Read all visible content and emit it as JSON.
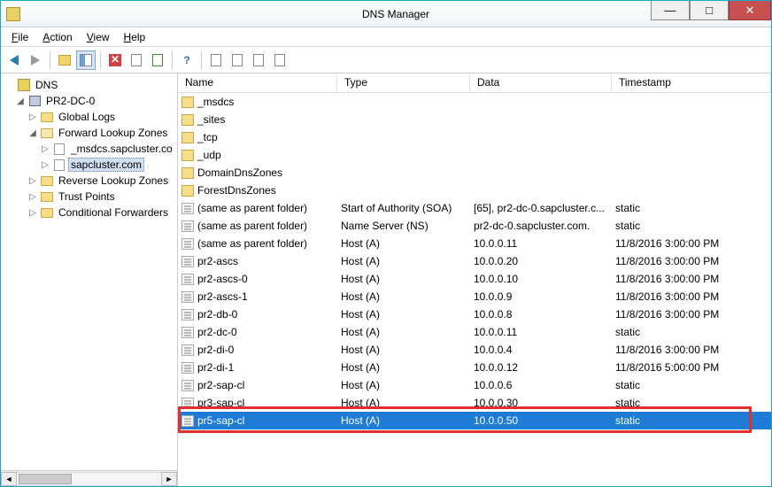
{
  "window": {
    "title": "DNS Manager"
  },
  "menus": {
    "file": "File",
    "action": "Action",
    "view": "View",
    "help": "Help"
  },
  "tree": {
    "root": "DNS",
    "server": "PR2-DC-0",
    "nodes": {
      "global_logs": "Global Logs",
      "fwd_zones": "Forward Lookup Zones",
      "zone_msdcs": "_msdcs.sapcluster.co",
      "zone_sap": "sapcluster.com",
      "rev_zones": "Reverse Lookup Zones",
      "trust_points": "Trust Points",
      "cond_fwd": "Conditional Forwarders"
    }
  },
  "columns": {
    "name": "Name",
    "type": "Type",
    "data": "Data",
    "ts": "Timestamp"
  },
  "rows": [
    {
      "kind": "folder",
      "name": "_msdcs",
      "type": "",
      "data": "",
      "ts": ""
    },
    {
      "kind": "folder",
      "name": "_sites",
      "type": "",
      "data": "",
      "ts": ""
    },
    {
      "kind": "folder",
      "name": "_tcp",
      "type": "",
      "data": "",
      "ts": ""
    },
    {
      "kind": "folder",
      "name": "_udp",
      "type": "",
      "data": "",
      "ts": ""
    },
    {
      "kind": "folder",
      "name": "DomainDnsZones",
      "type": "",
      "data": "",
      "ts": ""
    },
    {
      "kind": "folder",
      "name": "ForestDnsZones",
      "type": "",
      "data": "",
      "ts": ""
    },
    {
      "kind": "rec",
      "name": "(same as parent folder)",
      "type": "Start of Authority (SOA)",
      "data": "[65], pr2-dc-0.sapcluster.c...",
      "ts": "static"
    },
    {
      "kind": "rec",
      "name": "(same as parent folder)",
      "type": "Name Server (NS)",
      "data": "pr2-dc-0.sapcluster.com.",
      "ts": "static"
    },
    {
      "kind": "rec",
      "name": "(same as parent folder)",
      "type": "Host (A)",
      "data": "10.0.0.11",
      "ts": "11/8/2016 3:00:00 PM"
    },
    {
      "kind": "rec",
      "name": "pr2-ascs",
      "type": "Host (A)",
      "data": "10.0.0.20",
      "ts": "11/8/2016 3:00:00 PM"
    },
    {
      "kind": "rec",
      "name": "pr2-ascs-0",
      "type": "Host (A)",
      "data": "10.0.0.10",
      "ts": "11/8/2016 3:00:00 PM"
    },
    {
      "kind": "rec",
      "name": "pr2-ascs-1",
      "type": "Host (A)",
      "data": "10.0.0.9",
      "ts": "11/8/2016 3:00:00 PM"
    },
    {
      "kind": "rec",
      "name": "pr2-db-0",
      "type": "Host (A)",
      "data": "10.0.0.8",
      "ts": "11/8/2016 3:00:00 PM"
    },
    {
      "kind": "rec",
      "name": "pr2-dc-0",
      "type": "Host (A)",
      "data": "10.0.0.11",
      "ts": "static"
    },
    {
      "kind": "rec",
      "name": "pr2-di-0",
      "type": "Host (A)",
      "data": "10.0.0.4",
      "ts": "11/8/2016 3:00:00 PM"
    },
    {
      "kind": "rec",
      "name": "pr2-di-1",
      "type": "Host (A)",
      "data": "10.0.0.12",
      "ts": "11/8/2016 5:00:00 PM"
    },
    {
      "kind": "rec",
      "name": "pr2-sap-cl",
      "type": "Host (A)",
      "data": "10.0.0.6",
      "ts": "static"
    },
    {
      "kind": "rec",
      "name": "pr3-sap-cl",
      "type": "Host (A)",
      "data": "10.0.0.30",
      "ts": "static"
    },
    {
      "kind": "rec",
      "name": "pr5-sap-cl",
      "type": "Host (A)",
      "data": "10.0.0.50",
      "ts": "static",
      "selected": true,
      "highlighted": true
    }
  ]
}
